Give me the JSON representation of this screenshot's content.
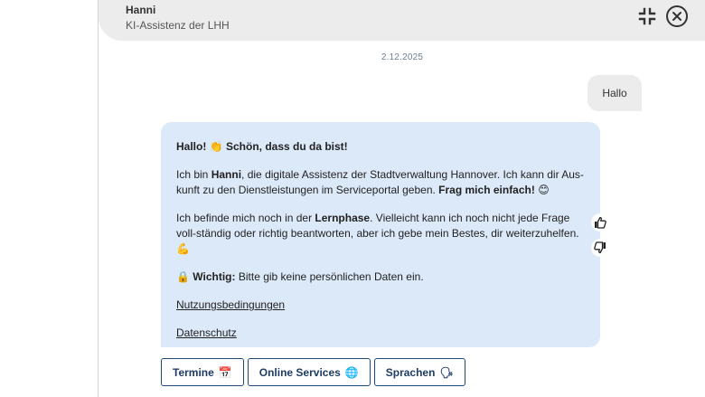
{
  "header": {
    "bot_name": "Hanni",
    "bot_subtitle": "KI-Assistenz der LHH",
    "minimize_icon": "minimize-icon",
    "close_icon": "close-circle-icon"
  },
  "date": "2.12.2025",
  "messages": {
    "user": "Hallo",
    "bot": {
      "greeting_bold": "Hallo!",
      "greeting_emoji": "👏",
      "greeting_rest": "Schön, dass du da bist!",
      "intro_1": "Ich bin ",
      "intro_name": "Hanni",
      "intro_2": ", die digitale Assistenz der Stadtverwaltung Hannover. Ich kann dir Aus-kunft zu den Dienstleistungen im Serviceportal geben. ",
      "intro_bold": "Frag mich einfach!",
      "intro_emoji": "😊",
      "learn_1": "Ich befinde mich noch in der ",
      "learn_bold": "Lernphase",
      "learn_2": ". Vielleicht kann ich noch nicht jede Frage voll-ständig oder richtig beantworten, aber ich gebe mein Bestes, dir weiterzuhelfen.",
      "learn_emoji": "💪",
      "warn_emoji": "🔒",
      "warn_bold": "Wichtig:",
      "warn_text": " Bitte gib keine persönlichen Daten ein.",
      "link_terms": "Nutzungsbedingungen",
      "link_privacy": "Datenschutz"
    }
  },
  "feedback": {
    "up_icon": "thumbs-up-icon",
    "down_icon": "thumbs-down-icon"
  },
  "quick_replies": [
    {
      "label": "Termine",
      "emoji": "📅"
    },
    {
      "label": "Online Services",
      "emoji": "🌐"
    },
    {
      "label": "Sprachen",
      "emoji": "🗣"
    }
  ],
  "colors": {
    "bot_bubble": "#dce9f9",
    "user_bubble": "#ececec",
    "header": "#ececec",
    "button_border": "#1e4a7a"
  }
}
